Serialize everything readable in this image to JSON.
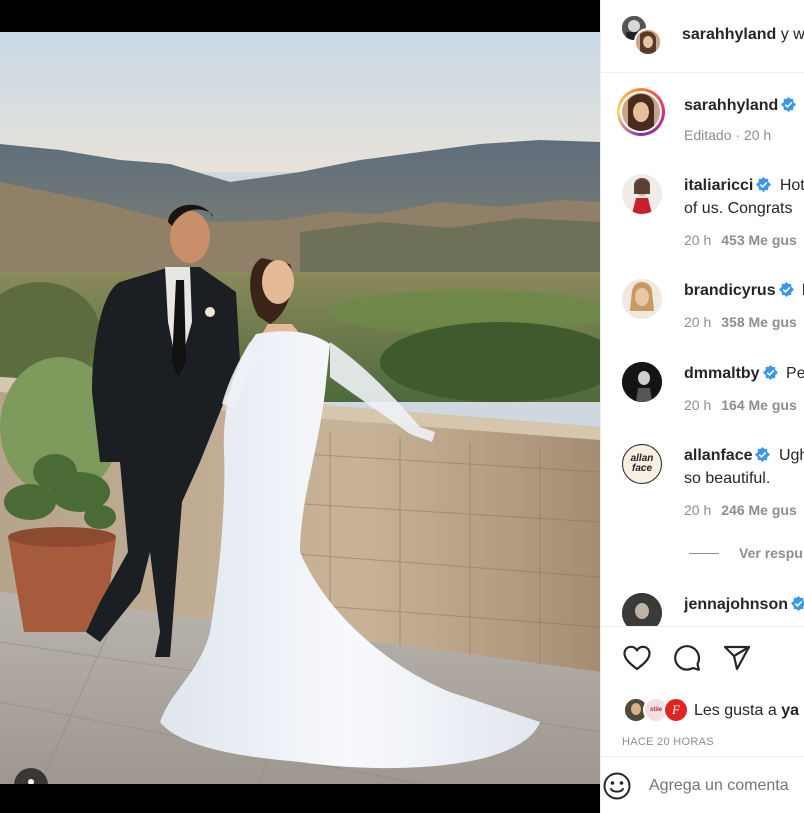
{
  "header": {
    "username": "sarahhyland",
    "coauthor_text": "y w"
  },
  "caption": {
    "username": "sarahhyland",
    "edited_time": "Editado · 20 h"
  },
  "comments": [
    {
      "username": "italiaricci",
      "text_line1": "Hot",
      "text_line2": "of us. Congrats",
      "time": "20 h",
      "likes": "453 Me gus",
      "verified": true
    },
    {
      "username": "brandicyrus",
      "text_line1": "l",
      "text_line2": "",
      "time": "20 h",
      "likes": "358 Me gus",
      "verified": true
    },
    {
      "username": "dmmaltby",
      "text_line1": "Pe",
      "text_line2": "",
      "time": "20 h",
      "likes": "164 Me gus",
      "verified": true
    },
    {
      "username": "allanface",
      "text_line1": "Ugh",
      "text_line2": "so beautiful.",
      "time": "20 h",
      "likes": "246 Me gus",
      "verified": true
    },
    {
      "username": "jennajohnson",
      "text_line1": "",
      "text_line2": "",
      "time": "",
      "likes": "",
      "verified": true
    }
  ],
  "view_replies": "Ver respu",
  "allanface_logo_text": "allan face",
  "likes_summary": {
    "text": "Les gusta a",
    "user": "ya",
    "avatar2_text": "stile",
    "avatar3_text": "F"
  },
  "timestamp": "HACE 20 HORAS",
  "comment_input": {
    "placeholder": "Agrega un comenta"
  },
  "icons": {
    "like": "heart-icon",
    "comment": "comment-bubble-icon",
    "share": "paper-plane-icon",
    "emoji": "emoji-icon",
    "verified": "verified-badge-icon",
    "user_tags": "user-icon"
  },
  "colors": {
    "verified": "#3897f0",
    "text": "#262626",
    "muted": "#8e8e8e",
    "divider": "#efefef"
  }
}
